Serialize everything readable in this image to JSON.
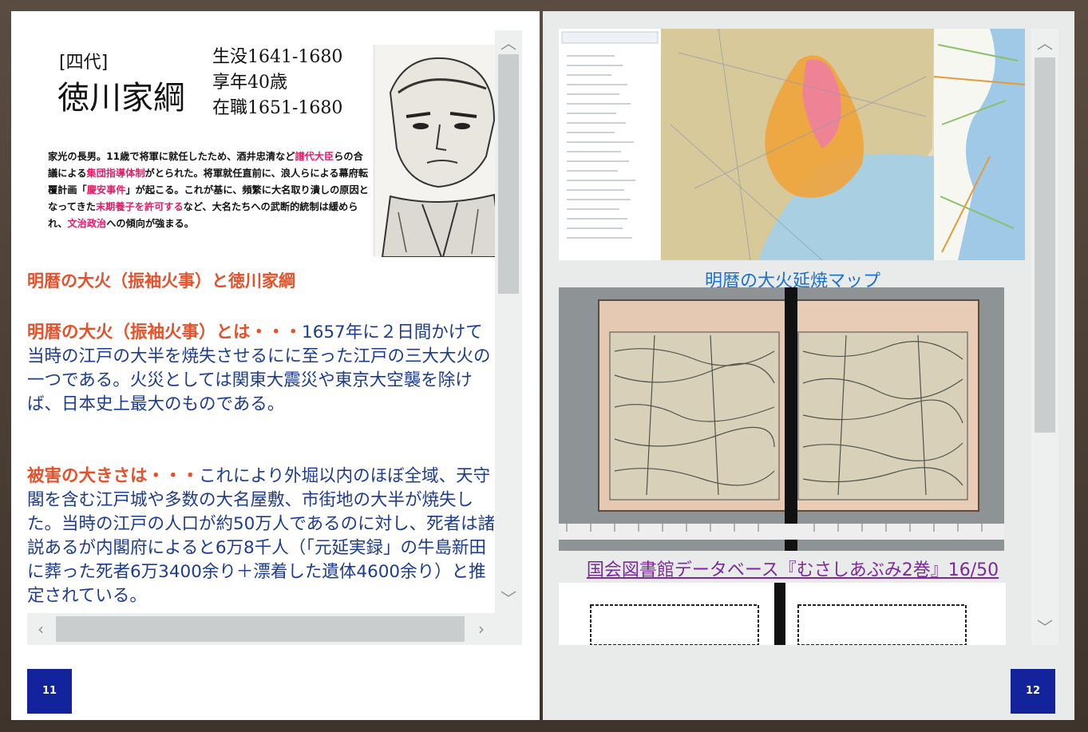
{
  "left_page": {
    "card": {
      "generation": "[四代]",
      "name": "徳川家綱",
      "facts": [
        "生没1641-1680",
        "享年40歳",
        "在職1651-1680"
      ],
      "bio": [
        {
          "t": "家光の長男。11歳で将軍に就任したため、酒井忠清など",
          "r": false
        },
        {
          "t": "譜代大臣",
          "r": true
        },
        {
          "t": "らの合議による",
          "r": false
        },
        {
          "t": "集団指導体制",
          "r": true
        },
        {
          "t": "がとられた。将軍就任直前に、浪人らによる幕府転覆計画「",
          "r": false
        },
        {
          "t": "慶安事件",
          "r": true
        },
        {
          "t": "」が起こる。これが基に、頻繁に大名取り潰しの原因となってきた",
          "r": false
        },
        {
          "t": "末期養子を許可する",
          "r": true
        },
        {
          "t": "など、大名たちへの武断的統制は緩められ、",
          "r": false
        },
        {
          "t": "文治政治",
          "r": true
        },
        {
          "t": "への傾向が強まる。",
          "r": false
        }
      ]
    },
    "heading": "明暦の大火（振袖火事）と徳川家綱",
    "paragraph1": {
      "lead": "明暦の大火（振袖火事）とは・・・",
      "body": "1657年に２日間かけて当時の江戸の大半を焼失させるにに至った江戸の三大大火の一つである。火災としては関東大震災や東京大空襲を除けば、日本史上最大のものである。"
    },
    "paragraph2": {
      "lead": "被害の大きさは・・・",
      "body": "これにより外堀以内のほぼ全域、天守閣を含む江戸城や多数の大名屋敷、市街地の大半が焼失した。当時の江戸の人口が約50万人であるのに対し、死者は諸説あるが内閣府によると6万8千人（「元延実録」の牛島新田に葬った死者6万3400余り＋漂着した遺体4600余り）と推定されている。"
    },
    "page_number": "11"
  },
  "right_page": {
    "map_link": "明暦の大火延焼マップ",
    "ndl_link": "国会図書館データベース『むさしあぶみ2巻』16/50",
    "page_number": "12"
  },
  "icons": {
    "up": "chevron-up-icon",
    "down": "chevron-down-icon",
    "left": "chevron-left-icon",
    "right": "chevron-right-icon"
  },
  "colors": {
    "accent_red": "#e8502a",
    "bio_highlight": "#e31c6a",
    "body_blue": "#1d3c8f",
    "link_blue": "#1a6fd0",
    "link_visited": "#7a2a9a",
    "page_badge": "#13239b"
  }
}
